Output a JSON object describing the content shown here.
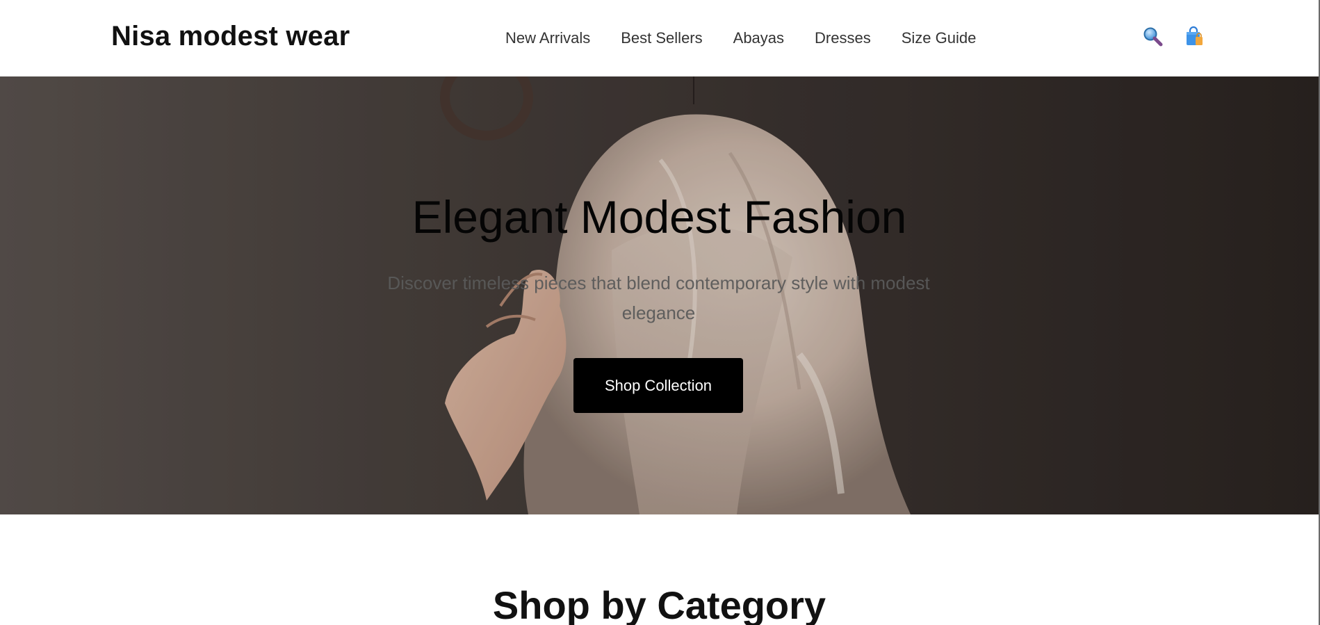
{
  "header": {
    "brand": "Nisa modest wear",
    "nav": [
      {
        "label": "New Arrivals"
      },
      {
        "label": "Best Sellers"
      },
      {
        "label": "Abayas"
      },
      {
        "label": "Dresses"
      },
      {
        "label": "Size Guide"
      }
    ],
    "icons": {
      "search": "search-icon",
      "cart": "shopping-bag-icon"
    }
  },
  "hero": {
    "title": "Elegant Modest Fashion",
    "subtitle": "Discover timeless pieces that blend contemporary style with modest elegance",
    "cta_label": "Shop Collection",
    "image": "woman-in-cream-headscarf-photo"
  },
  "categories_section": {
    "title": "Shop by Category"
  },
  "colors": {
    "button_bg": "#000000",
    "button_text": "#ffffff",
    "brand_text": "#111111",
    "nav_text": "#333333"
  }
}
